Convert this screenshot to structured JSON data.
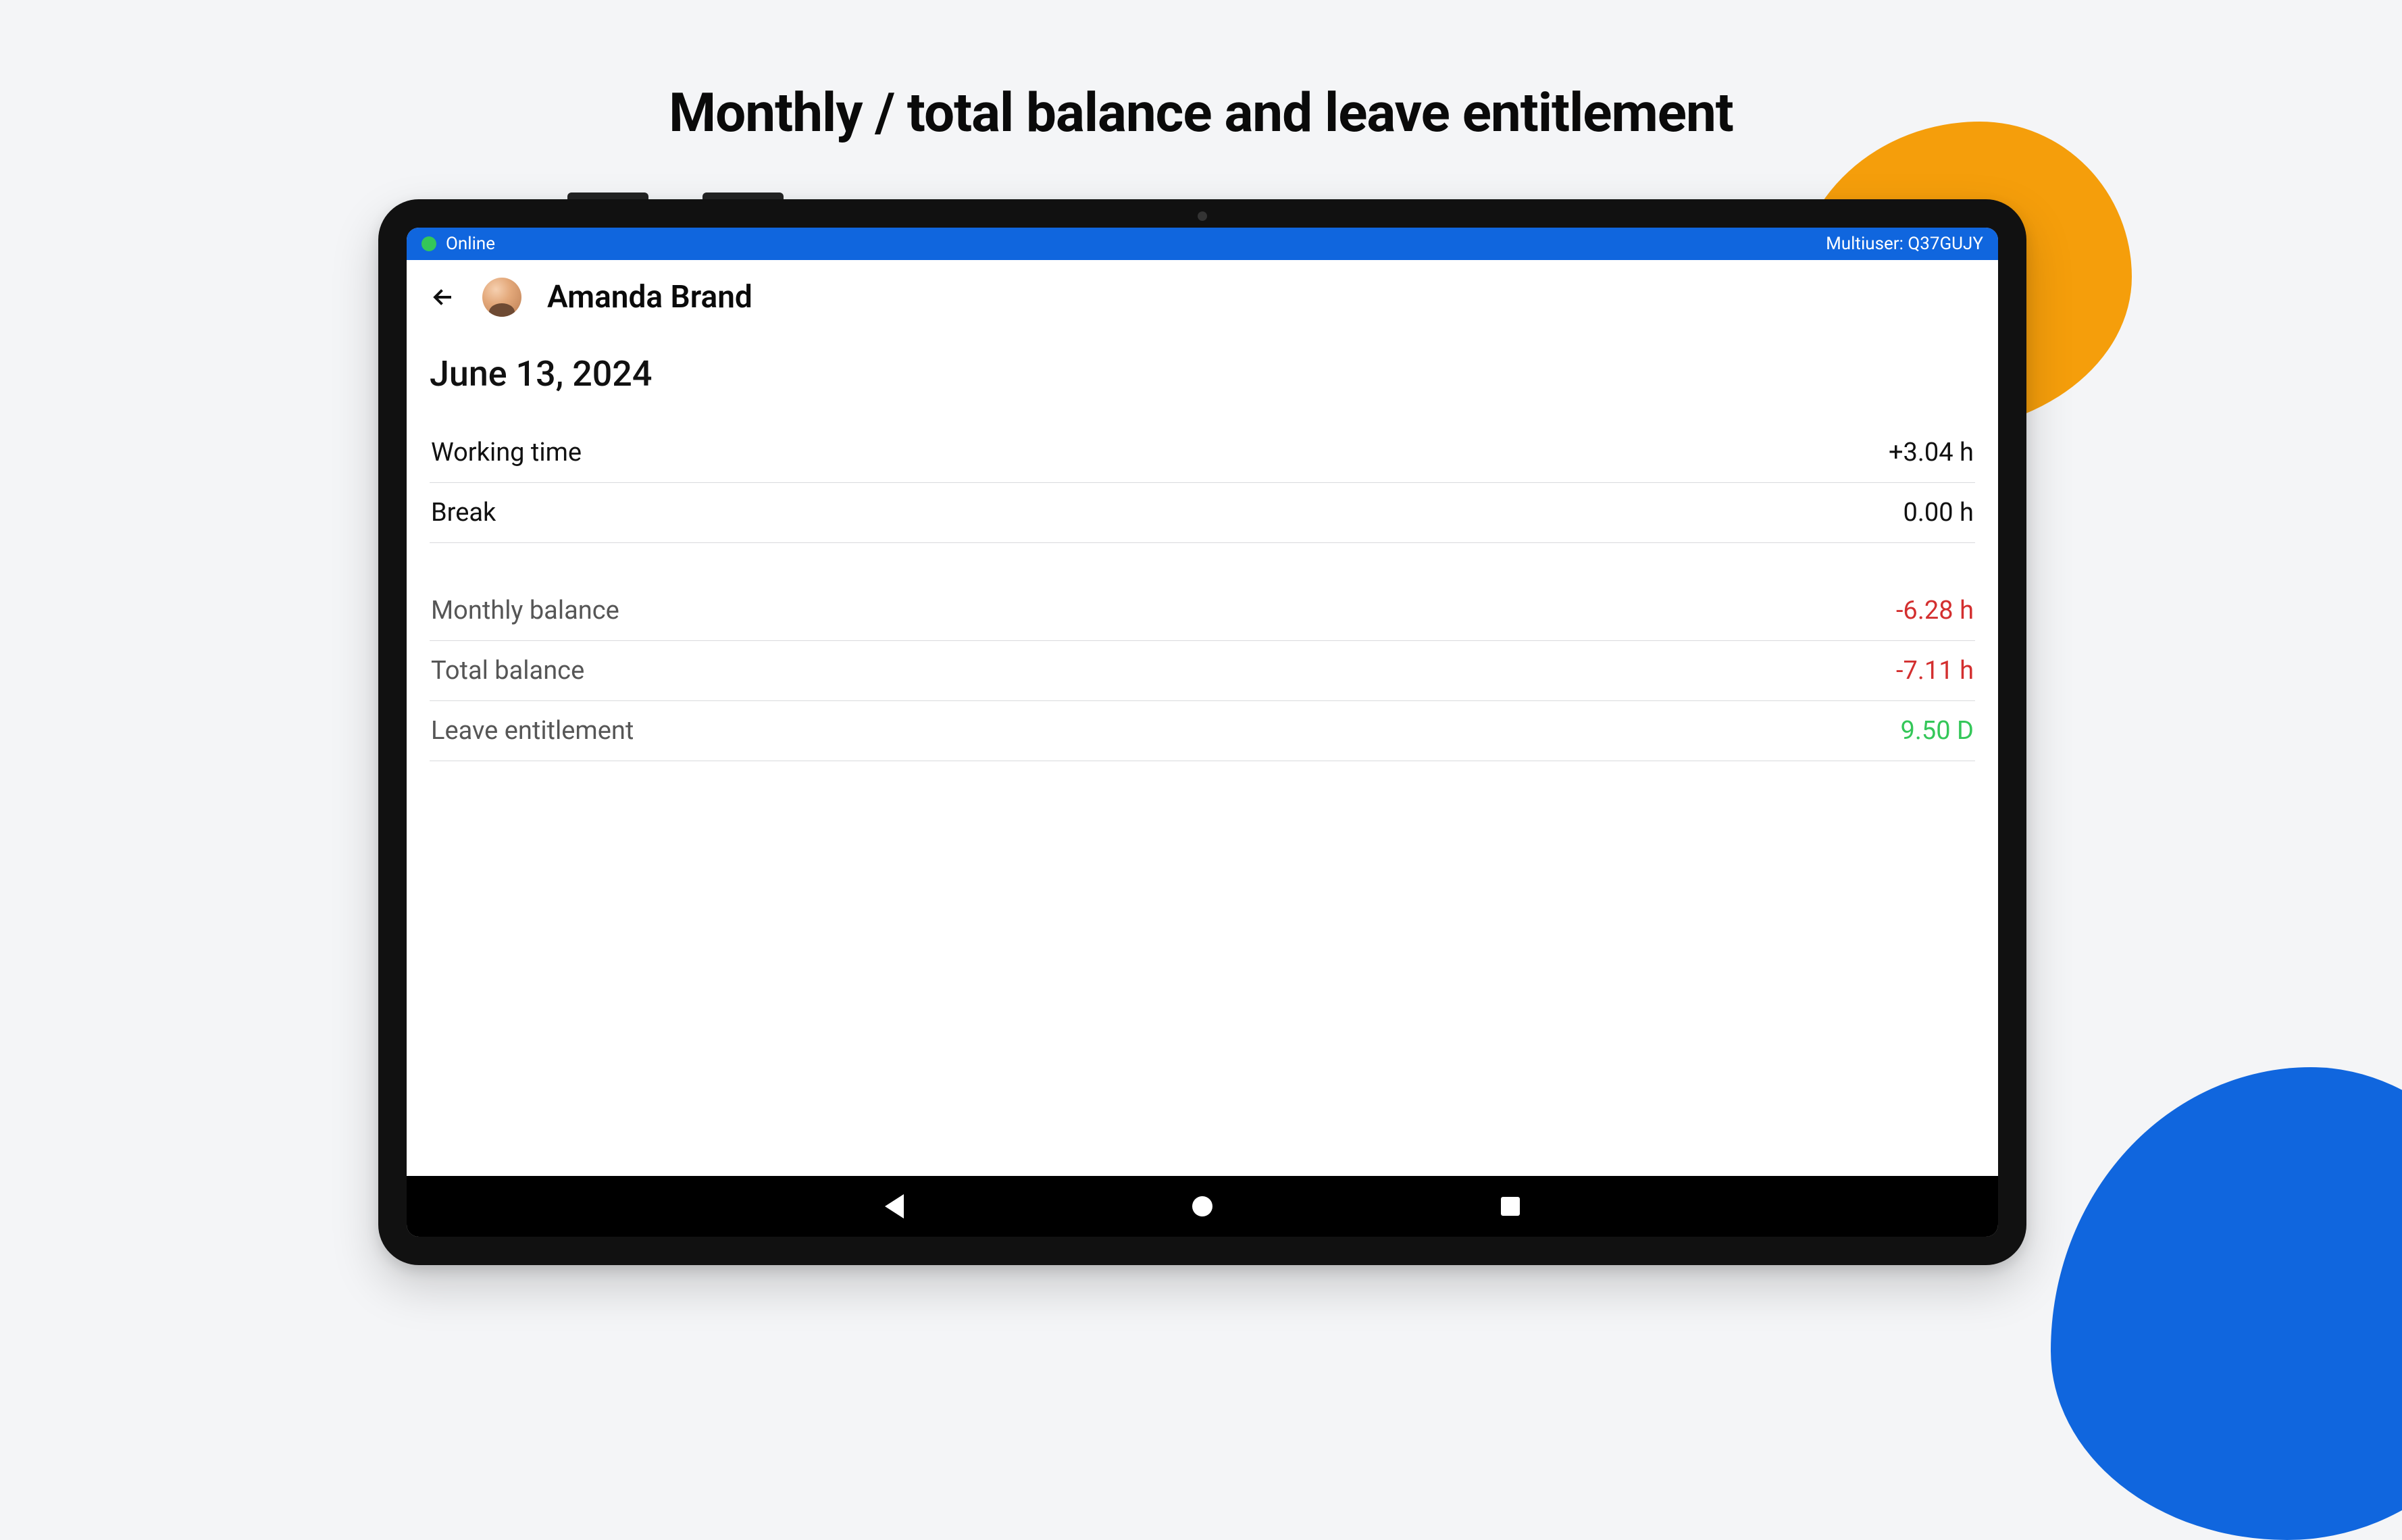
{
  "page_heading": "Monthly / total balance and leave entitlement",
  "statusbar": {
    "online_label": "Online",
    "multiuser_label": "Multiuser: Q37GUJY"
  },
  "header": {
    "user_name": "Amanda Brand"
  },
  "content": {
    "date": "June 13, 2024",
    "daily": [
      {
        "label": "Working time",
        "value": "+3.04 h",
        "tone": "normal"
      },
      {
        "label": "Break",
        "value": "0.00 h",
        "tone": "normal"
      }
    ],
    "balances": [
      {
        "label": "Monthly balance",
        "value": "-6.28 h",
        "tone": "neg"
      },
      {
        "label": "Total balance",
        "value": "-7.11 h",
        "tone": "neg"
      },
      {
        "label": "Leave entitlement",
        "value": "9.50 D",
        "tone": "pos"
      }
    ]
  },
  "colors": {
    "brand_blue": "#1066de",
    "accent_orange": "#f59e0b",
    "negative": "#d32f2f",
    "positive": "#34c759"
  }
}
